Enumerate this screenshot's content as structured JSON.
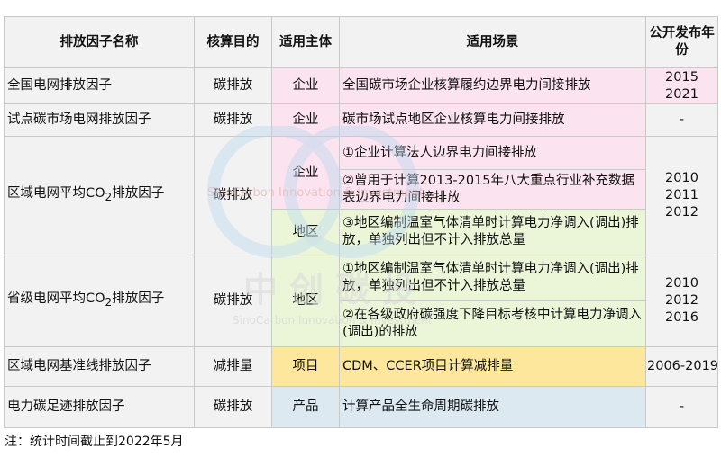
{
  "headers": [
    "排放因子名称",
    "核算目的",
    "适用主体",
    "适用场景",
    "公开发布年份"
  ],
  "rows": [
    {
      "name": "全国电网排放因子",
      "purpose": "碳排放",
      "subject": "企业",
      "scenarios": [
        "全国碳市场企业核算履约边界电力间接排放"
      ],
      "years": [
        "2015",
        "2021"
      ]
    },
    {
      "name": "试点碳市场电网排放因子",
      "purpose": "碳排放",
      "subject": "企业",
      "scenarios": [
        "碳市场试点地区企业核算电力间接排放"
      ],
      "years": [
        "-"
      ]
    },
    {
      "name_pre": "区域电网平均CO",
      "name_sub": "2",
      "name_post": "排放因子",
      "purpose": "碳排放",
      "subjects": [
        "企业",
        "地区"
      ],
      "scenarios": [
        "①企业计算法人边界电力间接排放",
        "②曾用于计算2013-2015年八大重点行业补充数据表边界电力间接排放",
        "③地区编制温室气体清单时计算电力净调入(调出)排放，单独列出但不计入排放总量"
      ],
      "years": [
        "2010",
        "2011",
        "2012"
      ]
    },
    {
      "name_pre": "省级电网平均CO",
      "name_sub": "2",
      "name_post": "排放因子",
      "purpose": "碳排放",
      "subject": "地区",
      "scenarios": [
        "①地区编制温室气体清单时计算电力净调入(调出)排放，单独列出但不计入排放总量",
        "②在各级政府碳强度下降目标考核中计算电力净调入(调出)的排放"
      ],
      "years": [
        "2010",
        "2012",
        "2016"
      ]
    },
    {
      "name": "区域电网基准线排放因子",
      "purpose": "减排量",
      "subject": "项目",
      "scenarios": [
        "CDM、CCER项目计算减排量"
      ],
      "years": [
        "2006-2019"
      ]
    },
    {
      "name": "电力碳足迹排放因子",
      "purpose": "碳排放",
      "subject": "产品",
      "scenarios": [
        "计算产品全生命周期碳排放"
      ],
      "years": [
        "-"
      ]
    }
  ],
  "watermark": {
    "cn": "中 创 碳 投",
    "en1": "SinoCarbon   Innovation & Investment",
    "en2": "SinoCarbon Innovation & Investment"
  },
  "note": "注：统计时间截止到2022年5月"
}
